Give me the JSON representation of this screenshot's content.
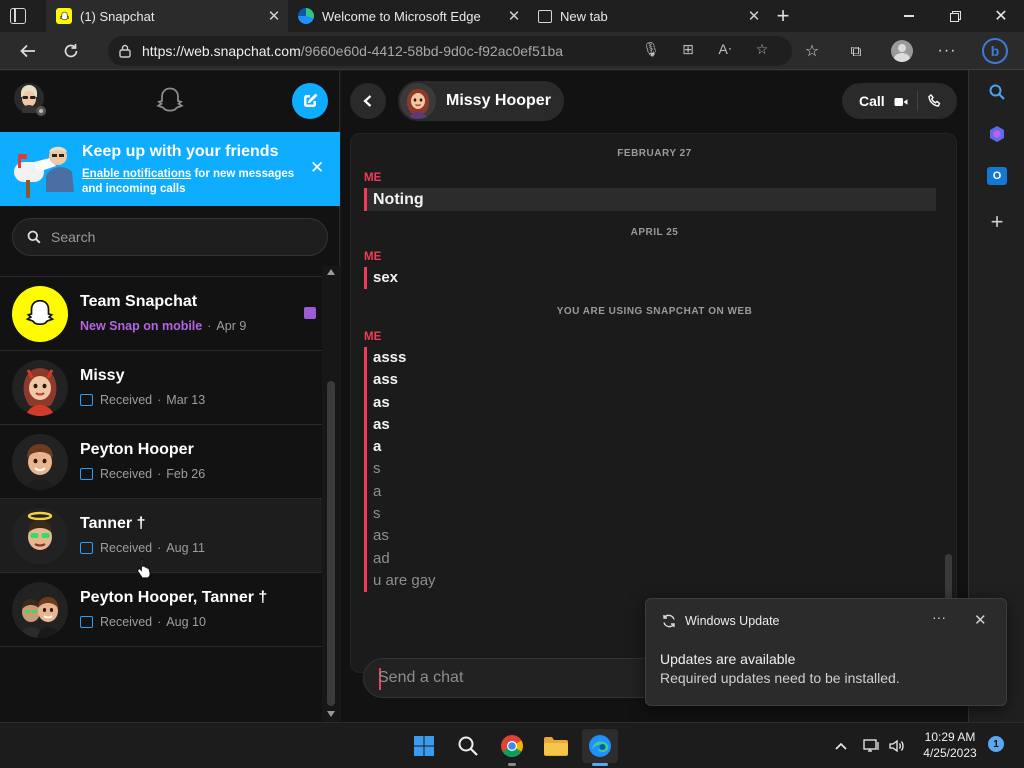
{
  "browser": {
    "tabs": [
      {
        "title": "(1) Snapchat",
        "active": true
      },
      {
        "title": "Welcome to Microsoft Edge",
        "active": false
      },
      {
        "title": "New tab",
        "active": false
      }
    ],
    "new_tab_label": "+",
    "url_host": "https://web.snapchat.com",
    "url_path": "/9660e60d-4412-58bd-9d0c-f92ac0ef51ba"
  },
  "snapchat": {
    "banner": {
      "title": "Keep up with your friends",
      "link": "Enable notifications",
      "rest": " for new messages and incoming calls"
    },
    "search_placeholder": "Search",
    "conversations": [
      {
        "name": "Team Snapchat",
        "status": "New Snap on mobile",
        "sep": "·",
        "date": "Apr 9",
        "kind": "new"
      },
      {
        "name": "Missy",
        "status": "Received",
        "sep": "·",
        "date": "Mar 13",
        "kind": "received"
      },
      {
        "name": "Peyton Hooper",
        "status": "Received",
        "sep": "·",
        "date": "Feb 26",
        "kind": "received"
      },
      {
        "name": "Tanner †",
        "status": "Received",
        "sep": "·",
        "date": "Aug 11",
        "kind": "received"
      },
      {
        "name": "Peyton Hooper,  Tanner †",
        "status": "Received",
        "sep": "·",
        "date": "Aug 10",
        "kind": "received"
      }
    ],
    "chat": {
      "contact_name": "Missy Hooper",
      "call_label": "Call",
      "sep1": "FEBRUARY 27",
      "sender": "ME",
      "msg1": "Noting",
      "sep2": "APRIL 25",
      "msg2": "sex",
      "sep3": "YOU ARE USING SNAPCHAT ON WEB",
      "lines": [
        "asss",
        "ass",
        "as",
        "as",
        "a",
        "s",
        "a",
        "s",
        "as",
        "ad",
        "u are gay"
      ],
      "composer_placeholder": "Send a chat"
    }
  },
  "toast": {
    "app": "Windows Update",
    "more": "···",
    "title": "Updates are available",
    "body": "Required updates need to be installed."
  },
  "taskbar": {
    "time": "10:29 AM",
    "date": "4/25/2023",
    "notification_count": "1"
  },
  "colors": {
    "snap_accent": "#f23c57",
    "banner_blue": "#0fadff",
    "purple": "#9e5bd6"
  }
}
